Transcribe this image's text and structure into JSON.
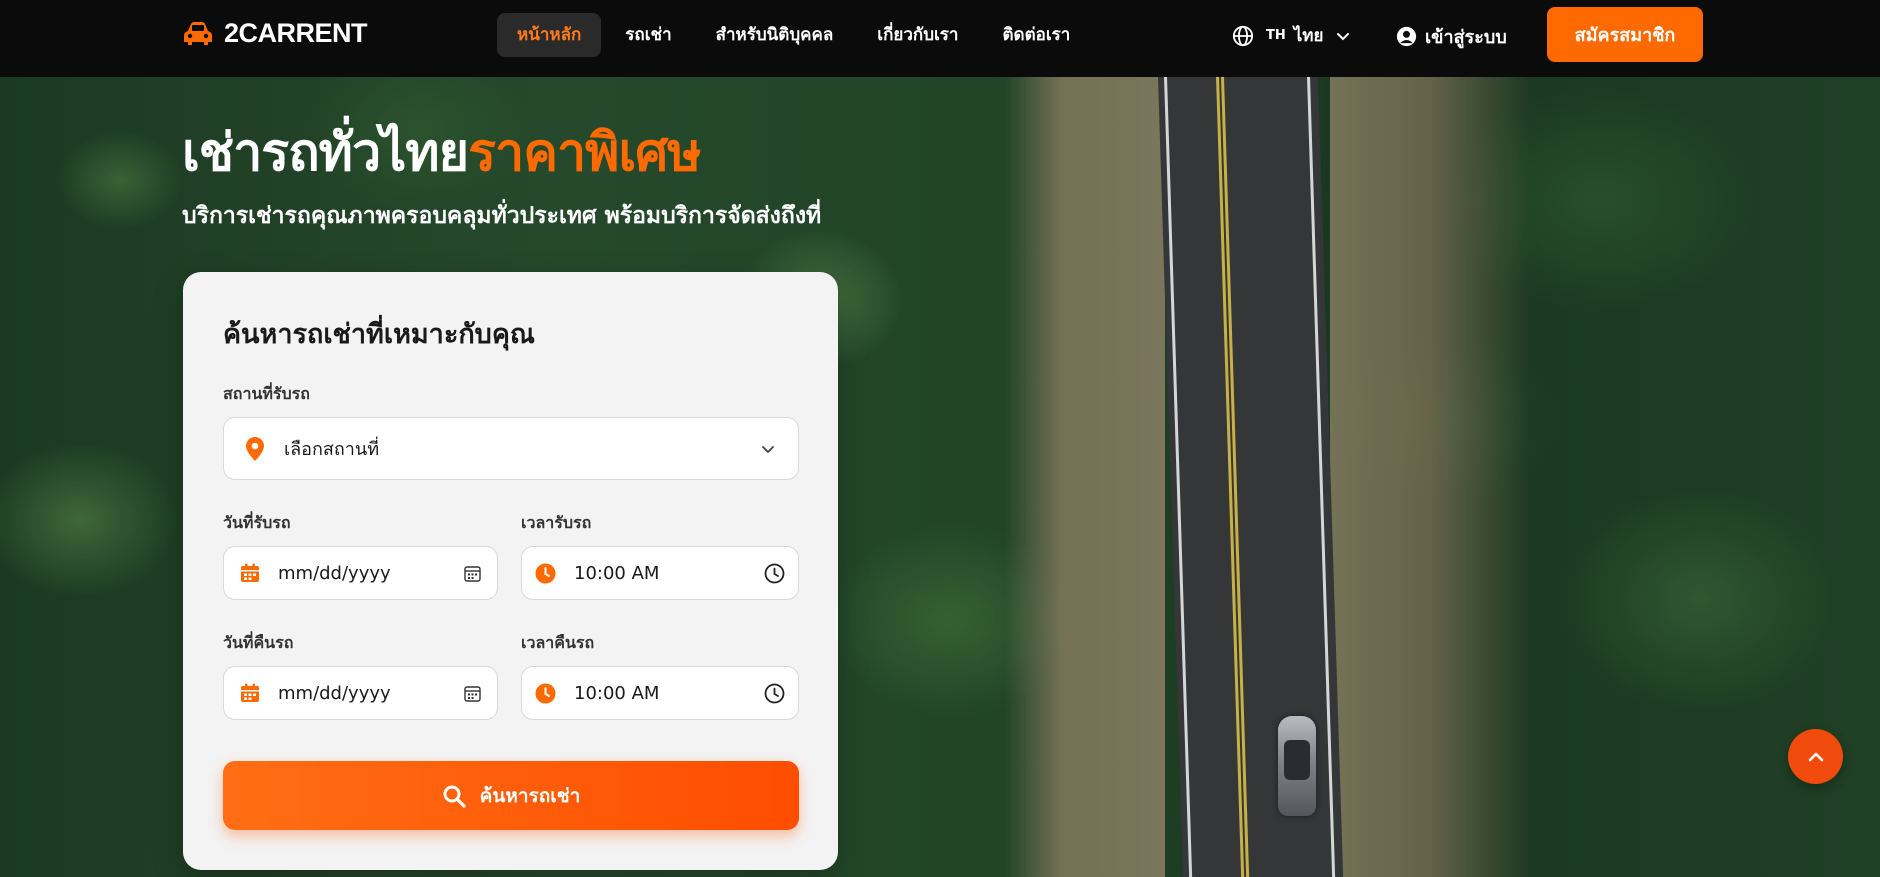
{
  "nav": {
    "brand": "2CARRENT",
    "menu": [
      {
        "label": "หน้าหลัก",
        "active": true
      },
      {
        "label": "รถเช่า",
        "active": false
      },
      {
        "label": "สำหรับนิติบุคคล",
        "active": false
      },
      {
        "label": "เกี่ยวกับเรา",
        "active": false
      },
      {
        "label": "ติดต่อเรา",
        "active": false
      }
    ],
    "language_code": "TH",
    "language_label": "ไทย",
    "login_label": "เข้าสู่ระบบ",
    "signup_label": "สมัครสมาชิก"
  },
  "hero": {
    "title_main": "เช่ารถทั่วไทย",
    "title_accent": "ราคาพิเศษ",
    "subtitle": "บริการเช่ารถคุณภาพครอบคลุมทั่วประเทศ พร้อมบริการจัดส่งถึงที่"
  },
  "search": {
    "title": "ค้นหารถเช่าที่เหมาะกับคุณ",
    "pickup_location_label": "สถานที่รับรถ",
    "pickup_location_value": "เลือกสถานที่",
    "pickup_date_label": "วันที่รับรถ",
    "pickup_date_value": "mm/dd/yyyy",
    "pickup_time_label": "เวลารับรถ",
    "pickup_time_value": "10:00 AM",
    "return_date_label": "วันที่คืนรถ",
    "return_date_value": "mm/dd/yyyy",
    "return_time_label": "เวลาคืนรถ",
    "return_time_value": "10:00 AM",
    "button_label": "ค้นหารถเช่า"
  },
  "colors": {
    "accent": "#ff6a00",
    "nav_bg": "#0b0b0b",
    "card_bg": "#f3f3f3"
  },
  "icons": {
    "logo": "car-icon",
    "language": "globe-icon",
    "login": "user-circle-icon",
    "location": "map-pin-icon",
    "date": "calendar-icon",
    "time": "clock-icon",
    "search": "search-icon",
    "scroll_top": "chevron-up-icon"
  }
}
